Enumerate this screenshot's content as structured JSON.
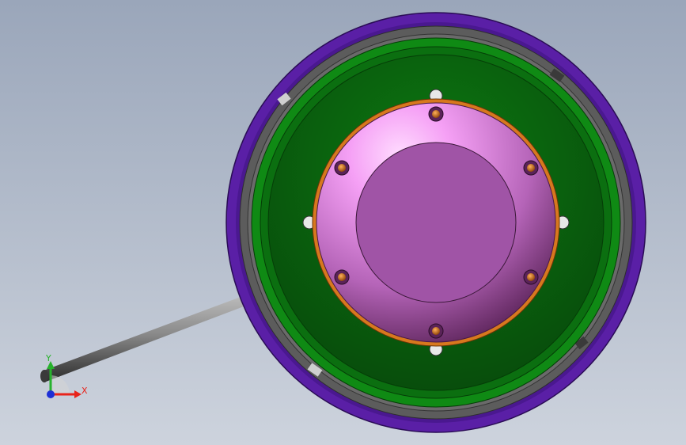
{
  "viewport": {
    "background_top": "#9aa6ba",
    "background_bottom": "#cdd3dd"
  },
  "triad": {
    "x_label": "X",
    "y_label": "Y",
    "x_color": "#e8231a",
    "y_color": "#27b22c",
    "z_color": "#1d2fd6"
  },
  "model": {
    "outer_ring_color": "#5a1fa6",
    "gray_ring_color": "#5c5c5c",
    "green_light": "#0f8a14",
    "green_dark": "#0a5c0e",
    "green_darker": "#084d0c",
    "copper_rim_color": "#d7781e",
    "pink_face_light": "#f7a9f7",
    "pink_face_dark": "#6a2a6a",
    "inner_disk_color": "#a054a6",
    "bolt_color": "#d46c12",
    "rod_color": "#6c6c6c"
  }
}
